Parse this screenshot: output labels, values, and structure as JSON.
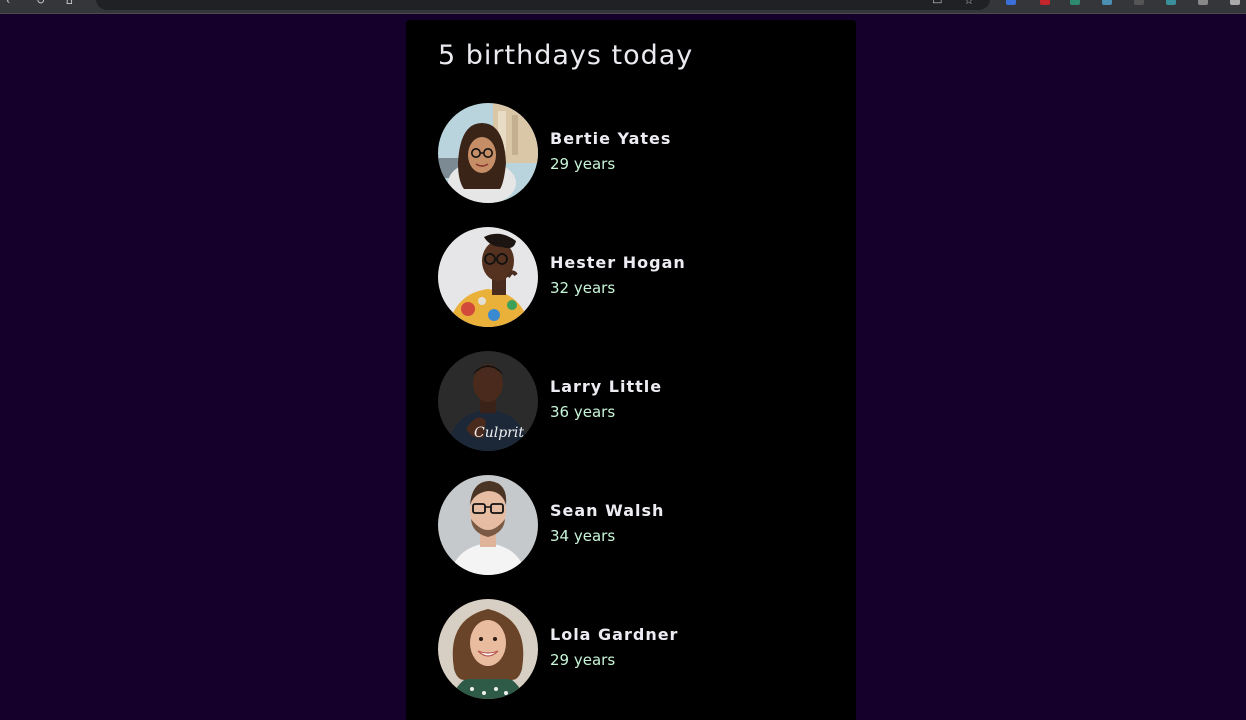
{
  "header": {
    "title": "5 birthdays today"
  },
  "people": [
    {
      "name": "Bertie Yates",
      "age": "29 years",
      "avatar": "woman-with-glasses-street-photo"
    },
    {
      "name": "Hester Hogan",
      "age": "32 years",
      "avatar": "woman-with-braids-floral-shirt-photo"
    },
    {
      "name": "Larry Little",
      "age": "36 years",
      "avatar": "man-dark-tshirt-photo",
      "shirt_text": "Culprit"
    },
    {
      "name": "Sean Walsh",
      "age": "34 years",
      "avatar": "man-with-glasses-beard-photo"
    },
    {
      "name": "Lola Gardner",
      "age": "29 years",
      "avatar": "woman-curly-hair-smiling-photo"
    }
  ],
  "colors": {
    "page_background": "#14002a",
    "card_background": "#000000",
    "name_text": "#ececf2",
    "age_text": "#c8f5d8"
  }
}
